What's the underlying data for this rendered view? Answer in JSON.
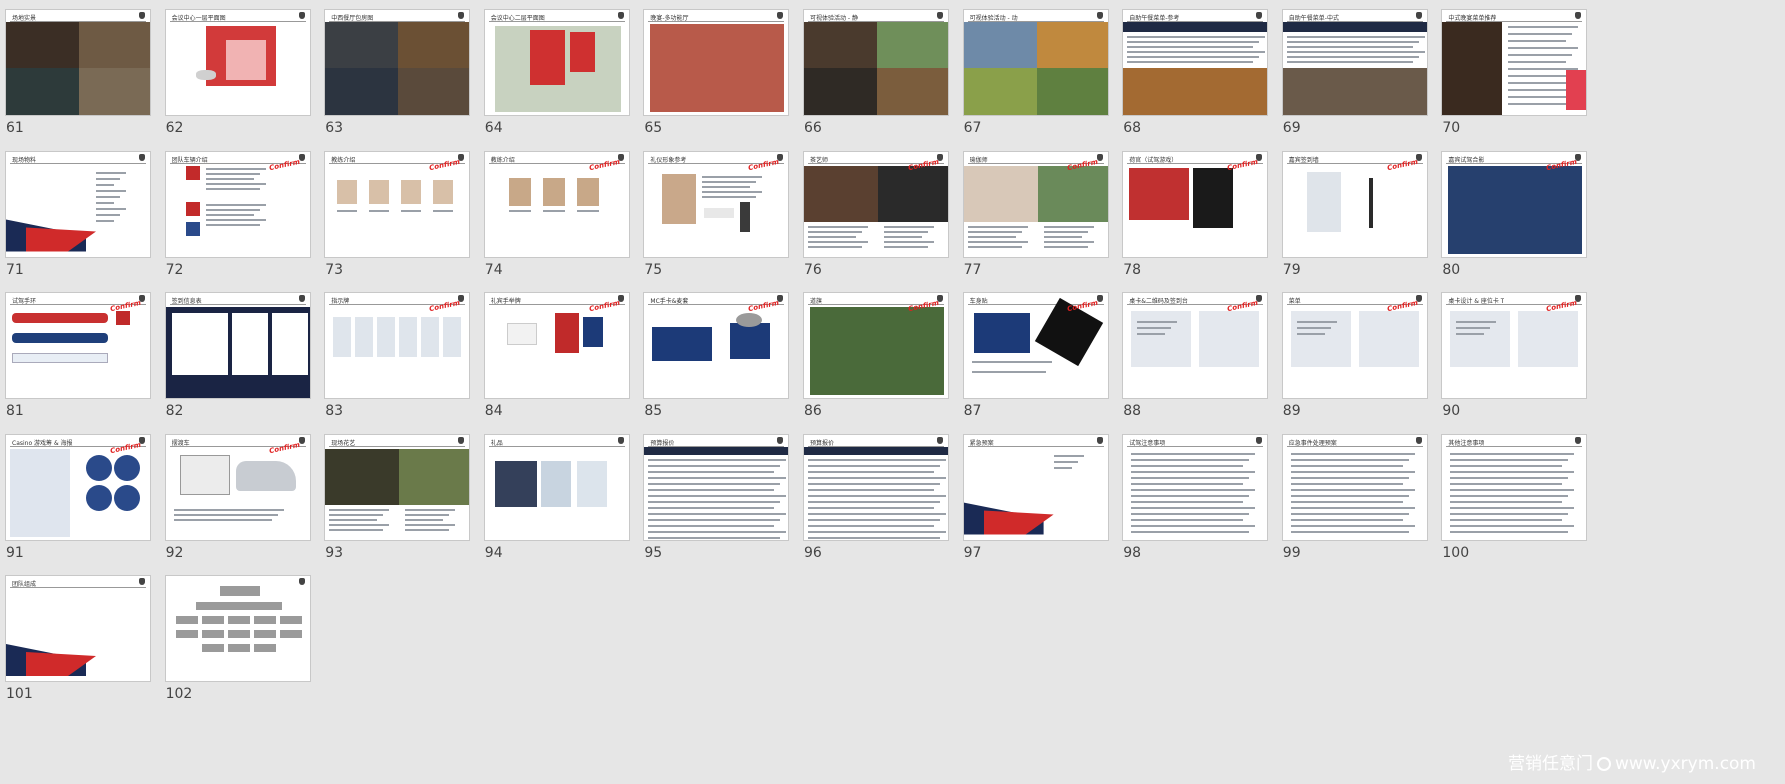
{
  "watermark": {
    "brand": "营销任意门",
    "url": "www.yxrym.com"
  },
  "confirm_label": "Confirm",
  "slides": [
    {
      "num": "61",
      "title": "场地实景",
      "kind": "photos4",
      "colors": [
        "#3b2e25",
        "#6e5a44",
        "#2d3a3a",
        "#7a6a55"
      ]
    },
    {
      "num": "62",
      "title": "会议中心一层平面图",
      "kind": "plan",
      "colors": [
        "#d23a3a",
        "#f1b3b3"
      ]
    },
    {
      "num": "63",
      "title": "中西餐厅包房图",
      "kind": "photos4",
      "colors": [
        "#3b3f44",
        "#6b5034",
        "#2c3440",
        "#5a4a3b"
      ]
    },
    {
      "num": "64",
      "title": "会议中心二层平面图",
      "kind": "plan2",
      "colors": [
        "#cf3030",
        "#8fa98a"
      ]
    },
    {
      "num": "65",
      "title": "晚宴-多功能厅",
      "kind": "single",
      "colors": [
        "#b85a4a"
      ]
    },
    {
      "num": "66",
      "title": "可视体验活动 - 静",
      "kind": "photos4",
      "colors": [
        "#4a3a2d",
        "#6f8f5a",
        "#2f2a25",
        "#7b5d3d"
      ]
    },
    {
      "num": "67",
      "title": "可视体验活动 - 动",
      "kind": "photos4",
      "colors": [
        "#6e8aa8",
        "#c0893e",
        "#8aa04a",
        "#5f8040"
      ]
    },
    {
      "num": "68",
      "title": "自助午餐菜单-参考",
      "kind": "menu",
      "colors": [
        "#1f2a44",
        "#a36a32"
      ]
    },
    {
      "num": "69",
      "title": "自助午餐菜单-中式",
      "kind": "menu",
      "colors": [
        "#1f2a44",
        "#6a5a4a"
      ]
    },
    {
      "num": "70",
      "title": "中式晚宴菜单推荐",
      "kind": "menu2",
      "colors": [
        "#3a2a1f",
        "#e24050"
      ]
    },
    {
      "num": "71",
      "title": "现场物料",
      "kind": "cover",
      "colors": [
        "#1a2a55",
        "#d02a2a"
      ]
    },
    {
      "num": "72",
      "title": "团队车辆介绍",
      "kind": "list",
      "colors": [
        "#c22a2a"
      ],
      "confirm": true
    },
    {
      "num": "73",
      "title": "教练介绍",
      "kind": "faces4",
      "colors": [
        "#2a2a2a"
      ],
      "confirm": true
    },
    {
      "num": "74",
      "title": "教练介绍",
      "kind": "faces3",
      "colors": [
        "#2a2a2a"
      ],
      "confirm": true
    },
    {
      "num": "75",
      "title": "礼仪形象参考",
      "kind": "hostess",
      "colors": [
        "#c9a88a"
      ],
      "confirm": true
    },
    {
      "num": "76",
      "title": "茶艺师",
      "kind": "photos3",
      "colors": [
        "#5a4030",
        "#2a2a2a",
        "#8a6a50"
      ],
      "confirm": true
    },
    {
      "num": "77",
      "title": "瑜伽师",
      "kind": "photos3",
      "colors": [
        "#d8c8b8",
        "#6a8a5a",
        "#a0b890"
      ],
      "confirm": true
    },
    {
      "num": "78",
      "title": "荷官（试驾游戏）",
      "kind": "photos2",
      "colors": [
        "#c03030",
        "#1a1a1a"
      ],
      "confirm": true
    },
    {
      "num": "79",
      "title": "嘉宾签到墙",
      "kind": "lanyard",
      "colors": [
        "#dfe4ea"
      ],
      "confirm": true
    },
    {
      "num": "80",
      "title": "嘉宾试驾合影",
      "kind": "single",
      "colors": [
        "#26406e"
      ],
      "confirm": true
    },
    {
      "num": "81",
      "title": "试驾手环",
      "kind": "bands",
      "colors": [
        "#c83030",
        "#1f3f7a",
        "#e8eef5"
      ],
      "confirm": true
    },
    {
      "num": "82",
      "title": "签到信息表",
      "kind": "docs",
      "colors": [
        "#1a2444"
      ],
      "confirm": false
    },
    {
      "num": "83",
      "title": "指示牌",
      "kind": "banners",
      "colors": [
        "#dfe5ec"
      ],
      "confirm": true
    },
    {
      "num": "84",
      "title": "礼宾手举牌",
      "kind": "signs",
      "colors": [
        "#1a1a1a",
        "#c02a2a"
      ],
      "confirm": true
    },
    {
      "num": "85",
      "title": "MC手卡&麦套",
      "kind": "mic",
      "colors": [
        "#1c3a78"
      ],
      "confirm": true
    },
    {
      "num": "86",
      "title": "道旗",
      "kind": "single",
      "colors": [
        "#4a6a3a"
      ],
      "confirm": true
    },
    {
      "num": "87",
      "title": "车身贴",
      "kind": "trident",
      "colors": [
        "#1c3a78",
        "#111111"
      ],
      "confirm": true
    },
    {
      "num": "88",
      "title": "桌卡&二维码及签到台",
      "kind": "cards",
      "colors": [
        "#e4e8ee"
      ],
      "confirm": true
    },
    {
      "num": "89",
      "title": "菜单",
      "kind": "cards",
      "colors": [
        "#e4e8ee"
      ],
      "confirm": true
    },
    {
      "num": "90",
      "title": "桌卡设计 & 座位卡 T",
      "kind": "cards",
      "colors": [
        "#e4e8ee"
      ],
      "confirm": true
    },
    {
      "num": "91",
      "title": "Casino 游戏筹 & 海报",
      "kind": "chips",
      "colors": [
        "#2a4a8a"
      ],
      "confirm": true
    },
    {
      "num": "92",
      "title": "摆渡车",
      "kind": "cars",
      "colors": [
        "#ececec"
      ],
      "confirm": true
    },
    {
      "num": "93",
      "title": "现场花艺",
      "kind": "photos3",
      "colors": [
        "#3a3a2a",
        "#6a7a4a",
        "#b0c090"
      ],
      "confirm": false
    },
    {
      "num": "94",
      "title": "礼品",
      "kind": "gifts",
      "colors": [
        "#34405a",
        "#c8d4e0"
      ],
      "confirm": false
    },
    {
      "num": "95",
      "title": "预算报价",
      "kind": "table",
      "colors": [
        "#1f2a44"
      ],
      "confirm": false
    },
    {
      "num": "96",
      "title": "预算报价",
      "kind": "table",
      "colors": [
        "#1f2a44"
      ],
      "confirm": false
    },
    {
      "num": "97",
      "title": "紧急预案",
      "kind": "cover2",
      "colors": [
        "#1a2a55",
        "#d02a2a"
      ],
      "confirm": false
    },
    {
      "num": "98",
      "title": "试驾注意事项",
      "kind": "text",
      "colors": [
        "#9aa0a8"
      ],
      "confirm": false
    },
    {
      "num": "99",
      "title": "应急事件处理预案",
      "kind": "text",
      "colors": [
        "#9aa0a8"
      ],
      "confirm": false
    },
    {
      "num": "100",
      "title": "其他注意事项",
      "kind": "text",
      "colors": [
        "#9aa0a8"
      ],
      "confirm": false
    },
    {
      "num": "101",
      "title": "团队组成",
      "kind": "cover3",
      "colors": [
        "#1a2a55",
        "#d02a2a"
      ],
      "confirm": false
    },
    {
      "num": "102",
      "title": "",
      "kind": "org",
      "colors": [
        "#9a9a9a"
      ],
      "confirm": false
    }
  ]
}
